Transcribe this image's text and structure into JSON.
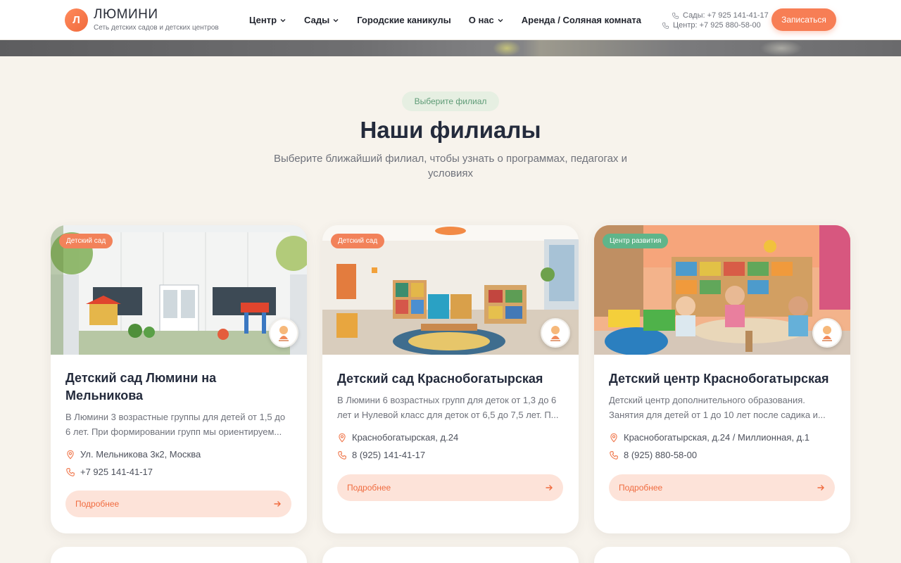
{
  "header": {
    "logo_letter": "Л",
    "logo_title": "ЛЮМИНИ",
    "logo_subtitle": "Сеть детских садов и детских центров",
    "nav": [
      {
        "label": "Центр",
        "dropdown": true
      },
      {
        "label": "Сады",
        "dropdown": true
      },
      {
        "label": "Городские каникулы",
        "dropdown": false
      },
      {
        "label": "О нас",
        "dropdown": true
      },
      {
        "label": "Аренда / Соляная комната",
        "dropdown": false
      }
    ],
    "phone_gardens": "Сады: +7 925 141-41-17",
    "phone_center": "Центр: +7 925 880-58-00",
    "cta_label": "Записаться"
  },
  "section": {
    "tag": "Выберите филиал",
    "title": "Наши филиалы",
    "subtitle": "Выберите ближайший филиал, чтобы узнать о программах, педагогах и условиях"
  },
  "cards": [
    {
      "badge": "Детский сад",
      "badge_color": "#f2825a",
      "title": "Детский сад Люмини на Мельникова",
      "description": "В Люмини 3 возрастные группы для детей от 1,5 до 6 лет. При формировании групп мы ориентируем...",
      "address": "Ул. Мельникова 3к2, Москва",
      "phone": "+7 925 141-41-17",
      "button": "Подробнее",
      "avatar_icon": "lumini-logo-icon"
    },
    {
      "badge": "Детский сад",
      "badge_color": "#f2825a",
      "title": "Детский сад Краснобогатырская",
      "description": "В Люмини 6 возрастных групп для деток от 1,3 до 6 лет и Нулевой класс для деток от 6,5 до 7,5 лет. П...",
      "address": "Краснобогатырская, д.24",
      "phone": "8 (925) 141-41-17",
      "button": "Подробнее",
      "avatar_icon": "lumini-logo-icon"
    },
    {
      "badge": "Центр развития",
      "badge_color": "#5fb58a",
      "title": "Детский центр Краснобогатырская",
      "description": "Детский центр дополнительного образования. Занятия для детей от 1 до 10 лет после садика и...",
      "address": "Краснобогатырская, д.24 / Миллионная, д.1",
      "phone": "8 (925) 880-58-00",
      "button": "Подробнее",
      "avatar_icon": "lumini-logo-icon"
    }
  ],
  "colors": {
    "accent": "#f77e55",
    "background": "#f7f3ec",
    "tag_green": "#5e9b76"
  }
}
